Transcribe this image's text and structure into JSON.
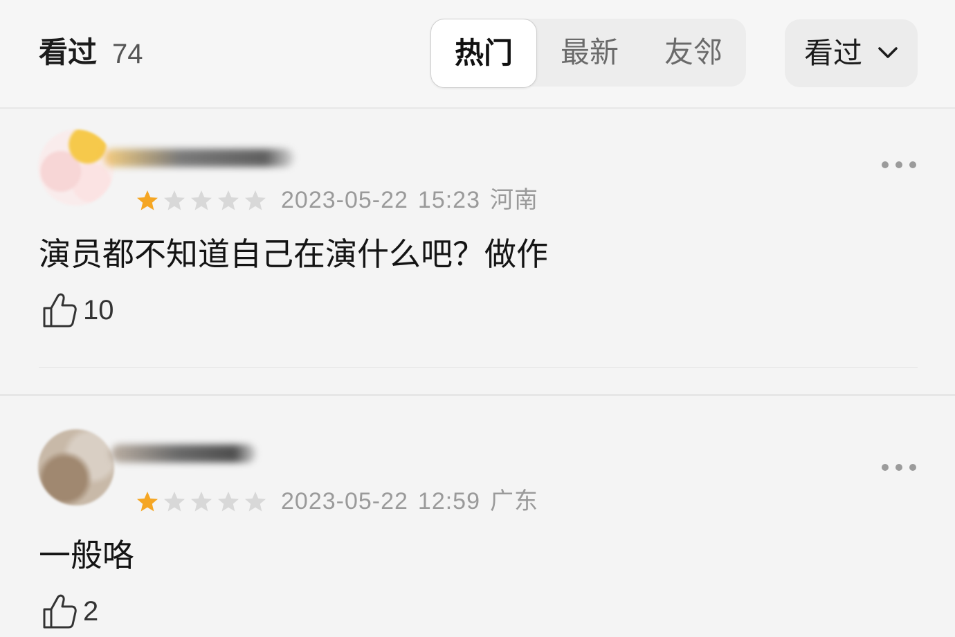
{
  "header": {
    "title": "看过",
    "count": "74",
    "tabs": [
      {
        "label": "热门",
        "active": true
      },
      {
        "label": "最新",
        "active": false
      },
      {
        "label": "友邻",
        "active": false
      }
    ],
    "filter": {
      "label": "看过",
      "icon": "chevron-down-icon"
    }
  },
  "comments": [
    {
      "rating": {
        "value": 1,
        "max": 5
      },
      "date": "2023-05-22",
      "time": "15:23",
      "location": "河南",
      "text": "演员都不知道自己在演什么吧？做作",
      "likes": "10"
    },
    {
      "rating": {
        "value": 1,
        "max": 5
      },
      "date": "2023-05-22",
      "time": "12:59",
      "location": "广东",
      "text": "一般咯",
      "likes": "2"
    }
  ],
  "colors": {
    "background": "#f4f4f4",
    "star_active": "#f5a623",
    "star_inactive": "#d8d8d8",
    "meta_text": "#9a9a9a"
  }
}
